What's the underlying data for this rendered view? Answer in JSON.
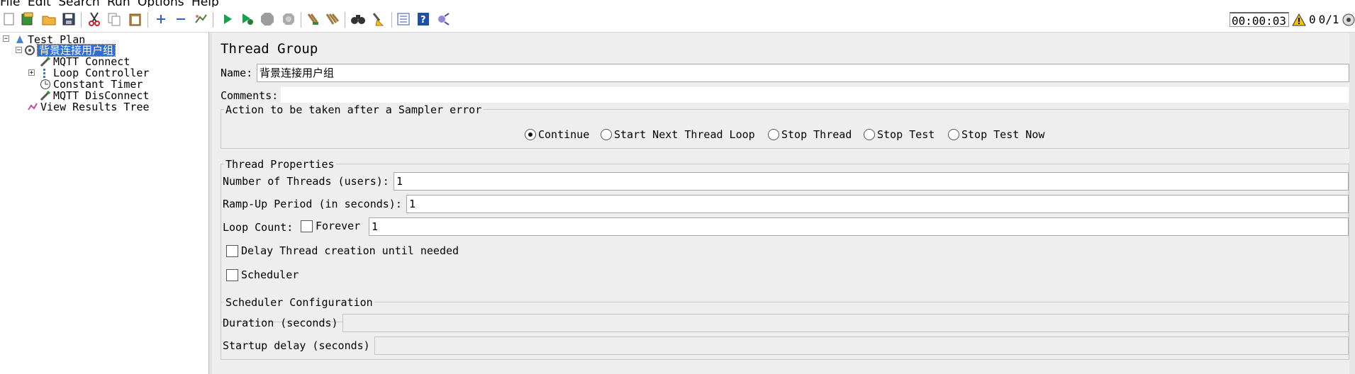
{
  "menu": [
    "File",
    "Edit",
    "Search",
    "Run",
    "Options",
    "Help"
  ],
  "toolbar": {
    "icons": [
      "new-icon",
      "templates-icon",
      "open-icon",
      "save-icon",
      "cut-icon",
      "copy-icon",
      "paste-icon",
      "expand-icon",
      "collapse-icon",
      "toggle-icon",
      "start-icon",
      "start-no-pauses-icon",
      "stop-icon",
      "shutdown-icon",
      "clear-icon",
      "clear-all-icon",
      "search-icon",
      "reset-search-icon",
      "function-helper-icon",
      "help-icon",
      "remote-icon"
    ],
    "timer": "00:00:03",
    "warning_count": "0",
    "threads": "0/1"
  },
  "tree": {
    "items": [
      {
        "label": "Test Plan",
        "icon": "test-plan-icon"
      },
      {
        "label": "背景连接用户组",
        "icon": "thread-group-icon",
        "selected": true
      },
      {
        "label": "MQTT Connect",
        "icon": "sampler-icon"
      },
      {
        "label": "Loop Controller",
        "icon": "loop-controller-icon"
      },
      {
        "label": "Constant Timer",
        "icon": "timer-icon"
      },
      {
        "label": "MQTT DisConnect",
        "icon": "sampler-icon"
      },
      {
        "label": "View Results Tree",
        "icon": "listener-icon"
      }
    ]
  },
  "panel": {
    "title": "Thread Group",
    "name_label": "Name:",
    "name_value": "背景连接用户组",
    "comments_label": "Comments:",
    "comments_value": "",
    "error_action": {
      "legend": "Action to be taken after a Sampler error",
      "options": [
        "Continue",
        "Start Next Thread Loop",
        "Stop Thread",
        "Stop Test",
        "Stop Test Now"
      ],
      "selected": "Continue"
    },
    "thread_props": {
      "legend": "Thread Properties",
      "threads_label": "Number of Threads (users):",
      "threads_value": "1",
      "rampup_label": "Ramp-Up Period (in seconds):",
      "rampup_value": "1",
      "loop_label": "Loop Count:",
      "forever_label": "Forever",
      "loop_value": "1",
      "delay_label": "Delay Thread creation until needed",
      "scheduler_label": "Scheduler"
    },
    "scheduler_config": {
      "legend": "Scheduler Configuration",
      "duration_label": "Duration (seconds)",
      "duration_value": "",
      "startup_label": "Startup delay (seconds)",
      "startup_value": ""
    }
  }
}
